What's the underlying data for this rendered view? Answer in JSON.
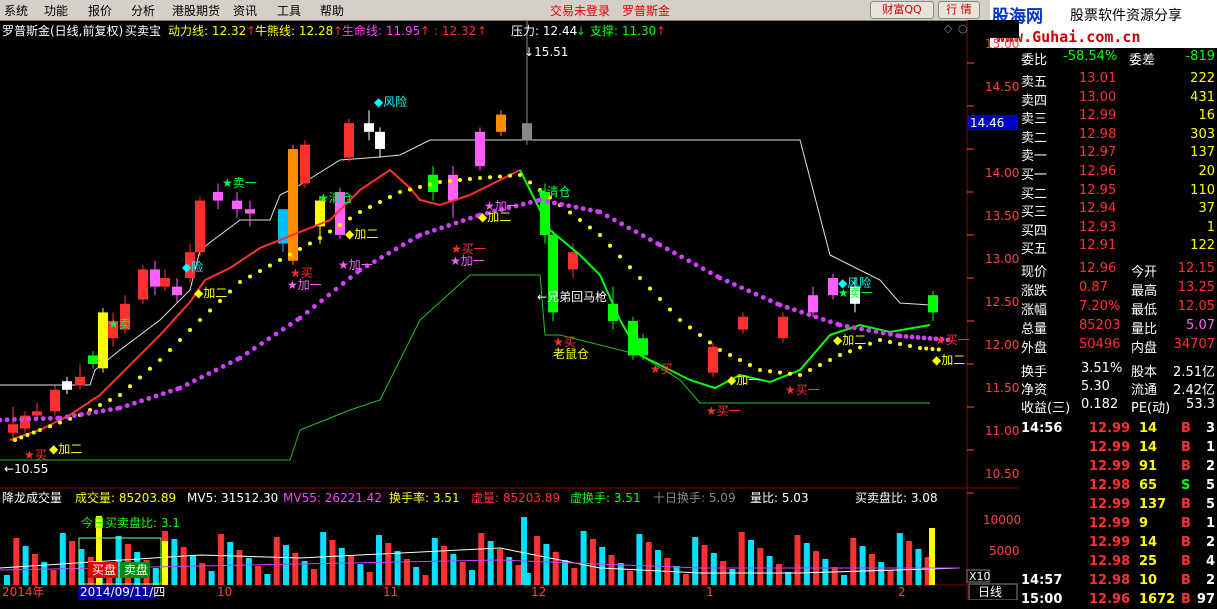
{
  "menu": [
    "系统",
    "功能",
    "报价",
    "分析",
    "港股期货",
    "资讯",
    "工具",
    "帮助"
  ],
  "status": {
    "login": "交易未登录",
    "stock": "罗普斯金"
  },
  "toolbar": {
    "fortune": "财富QQ",
    "quote": "行 情"
  },
  "logo": {
    "site": "股海网",
    "slogan": "股票软件资源分享",
    "url": "www.Guhai.com.cn"
  },
  "main_header": {
    "title": "罗普斯金(日线,前复权)",
    "indicator": "买卖宝",
    "dongli": "动力线: 12.32",
    "niuxiong": "牛熊线: 12.28",
    "shengming": "生命线: 11.95",
    "extra": ": 12.32",
    "pressure": "压力: 12.44",
    "support": "支撑: 11.30"
  },
  "price_axis": [
    "15.00",
    "14.50",
    "14.00",
    "13.50",
    "13.00",
    "12.50",
    "12.00",
    "11.50",
    "11.00",
    "10.50"
  ],
  "price_flag": "14.46",
  "annotations": {
    "high": "15.51",
    "low": "10.55",
    "risk": "风险",
    "risk2": "风险",
    "sell1": "卖一",
    "sell1b": "卖一",
    "clear1": "清仓",
    "clear2": "清仓",
    "buy1": "买一",
    "buy1b": "买一",
    "buy1c": "买一",
    "buy1d": "买一",
    "add1": "加一",
    "add1b": "加一",
    "add2": "加二",
    "add2b": "加二",
    "add2c": "加二",
    "add2d": "加二",
    "add2e": "加二",
    "add2f": "加二",
    "sell": "卖",
    "buy": "买",
    "buy2": "买",
    "buy3": "买",
    "buy4": "买",
    "rat": "老鼠仓",
    "brother": "兄弟回马枪"
  },
  "vol_header": {
    "title": "降龙成交量",
    "vol": "成交量: 85203.89",
    "mv5": "MV5: 31512.30",
    "mv55": "MV55: 26221.42",
    "turnover": "换手率: 3.51",
    "vvol": "虚量: 85203.89",
    "vturn": "虚换手: 3.51",
    "turn10": "十日换手: 5.09",
    "vr": "量比: 5.03",
    "bsr": "买卖盘比: 3.08"
  },
  "vol_panel": {
    "today": "今日买卖盘比: 3.1",
    "buy": "买盘",
    "sell": "卖盘"
  },
  "vol_axis": [
    "10000",
    "5000"
  ],
  "vol_unit": "X10",
  "date_axis": {
    "year": "2014年",
    "cursor": "2014/09/11/四",
    "m10": "10",
    "m11": "11",
    "m12": "12",
    "m1": "1",
    "m2": "2"
  },
  "period_tab": "日线",
  "quote": {
    "ratio": {
      "label": "委比",
      "value": "-58.54%",
      "label2": "委差",
      "value2": "-819"
    },
    "asks": [
      {
        "label": "卖五",
        "price": "13.01",
        "vol": "222"
      },
      {
        "label": "卖四",
        "price": "13.00",
        "vol": "431"
      },
      {
        "label": "卖三",
        "price": "12.99",
        "vol": "16"
      },
      {
        "label": "卖二",
        "price": "12.98",
        "vol": "303"
      },
      {
        "label": "卖一",
        "price": "12.97",
        "vol": "137"
      }
    ],
    "bids": [
      {
        "label": "买一",
        "price": "12.96",
        "vol": "20"
      },
      {
        "label": "买二",
        "price": "12.95",
        "vol": "110"
      },
      {
        "label": "买三",
        "price": "12.94",
        "vol": "37"
      },
      {
        "label": "买四",
        "price": "12.93",
        "vol": "1"
      },
      {
        "label": "买五",
        "price": "12.91",
        "vol": "122"
      }
    ],
    "stats": [
      {
        "l1": "现价",
        "v1": "12.96",
        "l2": "今开",
        "v2": "12.15"
      },
      {
        "l1": "涨跌",
        "v1": "0.87",
        "l2": "最高",
        "v2": "13.25"
      },
      {
        "l1": "涨幅",
        "v1": "7.20%",
        "l2": "最低",
        "v2": "12.05"
      },
      {
        "l1": "总量",
        "v1": "85203",
        "l2": "量比",
        "v2": "5.07"
      },
      {
        "l1": "外盘",
        "v1": "50496",
        "l2": "内盘",
        "v2": "34707"
      }
    ],
    "fund": [
      {
        "l1": "换手",
        "v1": "3.51%",
        "l2": "股本",
        "v2": "2.51亿"
      },
      {
        "l1": "净资",
        "v1": "5.30",
        "l2": "流通",
        "v2": "2.42亿"
      },
      {
        "l1": "收益(三)",
        "v1": "0.182",
        "l2": "PE(动)",
        "v2": "53.3"
      }
    ],
    "ticks": [
      {
        "time": "14:56",
        "price": "12.99",
        "vol": "14",
        "side": "B",
        "n": "3"
      },
      {
        "time": "",
        "price": "12.99",
        "vol": "14",
        "side": "B",
        "n": "1"
      },
      {
        "time": "",
        "price": "12.99",
        "vol": "91",
        "side": "B",
        "n": "2"
      },
      {
        "time": "",
        "price": "12.98",
        "vol": "65",
        "side": "S",
        "n": "5"
      },
      {
        "time": "",
        "price": "12.99",
        "vol": "137",
        "side": "B",
        "n": "5"
      },
      {
        "time": "",
        "price": "12.99",
        "vol": "9",
        "side": "B",
        "n": "1"
      },
      {
        "time": "",
        "price": "12.99",
        "vol": "14",
        "side": "B",
        "n": "2"
      },
      {
        "time": "",
        "price": "12.98",
        "vol": "25",
        "side": "B",
        "n": "4"
      },
      {
        "time": "14:57",
        "price": "12.98",
        "vol": "10",
        "side": "B",
        "n": "2"
      },
      {
        "time": "15:00",
        "price": "12.96",
        "vol": "1672",
        "side": "B",
        "n": "97"
      }
    ]
  }
}
